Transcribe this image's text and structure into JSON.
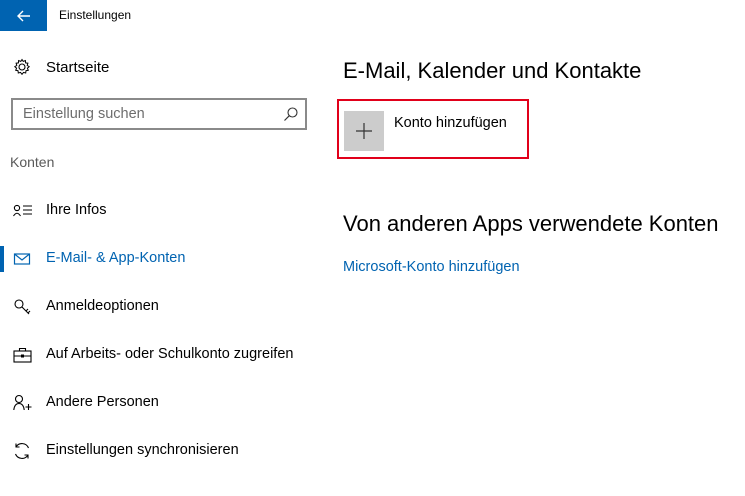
{
  "window": {
    "title": "Einstellungen"
  },
  "sidebar": {
    "home_label": "Startseite",
    "search_placeholder": "Einstellung suchen",
    "section_label": "Konten",
    "items": [
      {
        "label": "Ihre Infos",
        "icon": "person-info-icon",
        "active": false
      },
      {
        "label": "E-Mail- & App-Konten",
        "icon": "mail-icon",
        "active": true
      },
      {
        "label": "Anmeldeoptionen",
        "icon": "key-icon",
        "active": false
      },
      {
        "label": "Auf Arbeits- oder Schulkonto zugreifen",
        "icon": "briefcase-icon",
        "active": false
      },
      {
        "label": "Andere Personen",
        "icon": "person-add-icon",
        "active": false
      },
      {
        "label": "Einstellungen synchronisieren",
        "icon": "sync-icon",
        "active": false
      }
    ]
  },
  "main": {
    "email_section_title": "E-Mail, Kalender und Kontakte",
    "add_account_label": "Konto hinzufügen",
    "other_apps_title": "Von anderen Apps verwendete Konten",
    "microsoft_account_link": "Microsoft-Konto hinzufügen"
  },
  "colors": {
    "accent": "#0063b1",
    "highlight_border": "#e1001a",
    "tile": "#cccccc"
  }
}
